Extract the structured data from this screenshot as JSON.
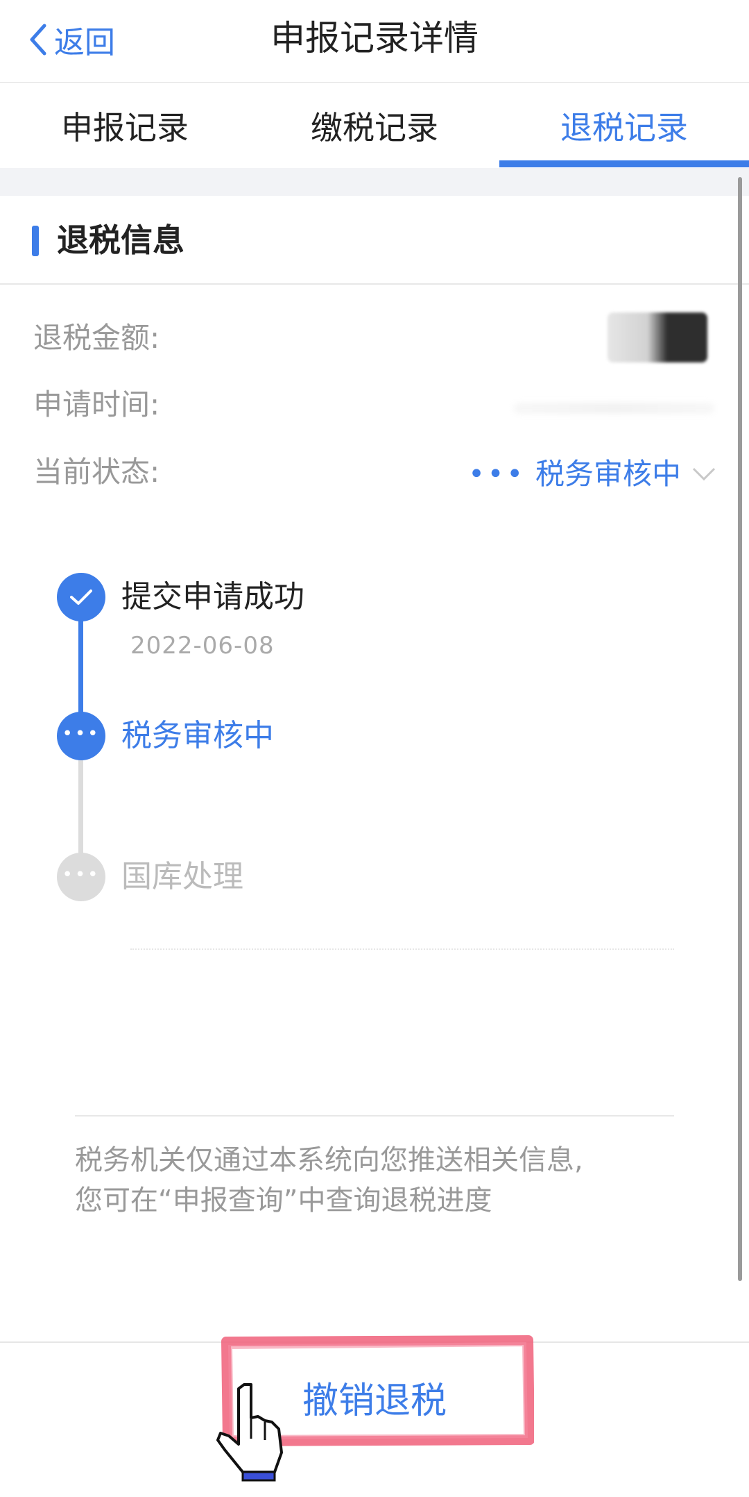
{
  "nav": {
    "back_label": "返回",
    "title": "申报记录详情"
  },
  "tabs": [
    {
      "label": "申报记录",
      "active": false
    },
    {
      "label": "缴税记录",
      "active": false
    },
    {
      "label": "退税记录",
      "active": true
    }
  ],
  "section": {
    "title": "退税信息"
  },
  "fields": {
    "amount_label": "退税金额:",
    "time_label": "申请时间:",
    "status_label": "当前状态:",
    "status_value": "税务审核中"
  },
  "timeline": [
    {
      "title": "提交申请成功",
      "date": "2022-06-08",
      "state": "done"
    },
    {
      "title": "税务审核中",
      "state": "current"
    },
    {
      "title": "国库处理",
      "state": "pending"
    }
  ],
  "note": {
    "line1": "税务机关仅通过本系统向您推送相关信息,",
    "line2": "您可在“申报查询”中查询退税进度"
  },
  "bottom": {
    "cancel_label": "撤销退税"
  },
  "colors": {
    "accent": "#3d7de8",
    "highlight": "#f0607a",
    "pending": "#dcdcdc"
  },
  "icons": [
    "back-chevron-icon",
    "check-icon",
    "dots-icon",
    "chevron-down-icon",
    "hand-pointer-icon"
  ]
}
